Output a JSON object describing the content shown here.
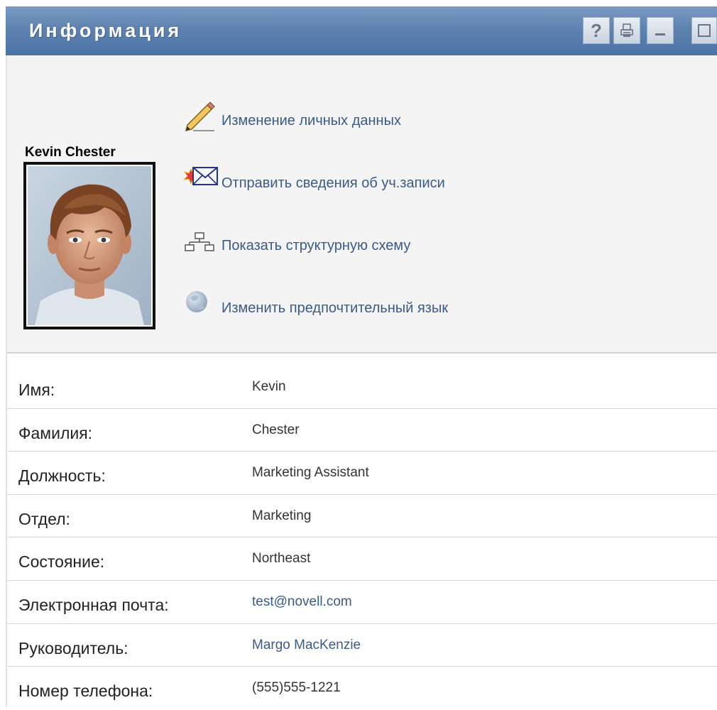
{
  "window": {
    "title": "Информация",
    "buttons": {
      "help_label": "?",
      "print_icon": "printer-icon",
      "minimize_icon": "minimize-icon",
      "maximize_icon": "maximize-icon"
    }
  },
  "user": {
    "name": "Kevin Chester",
    "photo_icon": "user-photo"
  },
  "actions": [
    {
      "icon": "pencil-icon",
      "label": "Изменение личных данных"
    },
    {
      "icon": "envelope-icon",
      "label": "Отправить сведения об уч.записи"
    },
    {
      "icon": "org-chart-icon",
      "label": "Показать структурную схему"
    },
    {
      "icon": "globe-icon",
      "label": "Изменить предпочтительный язык"
    }
  ],
  "details": [
    {
      "label": "Имя:",
      "value": "Kevin",
      "is_link": false
    },
    {
      "label": "Фамилия:",
      "value": "Chester",
      "is_link": false
    },
    {
      "label": "Должность:",
      "value": "Marketing Assistant",
      "is_link": false
    },
    {
      "label": "Отдел:",
      "value": "Marketing",
      "is_link": false
    },
    {
      "label": "Состояние:",
      "value": "Northeast",
      "is_link": false
    },
    {
      "label": "Электронная почта:",
      "value": "test@novell.com",
      "is_link": true
    },
    {
      "label": "Руководитель:",
      "value": "Margo MacKenzie",
      "is_link": true
    },
    {
      "label": "Номер телефона:",
      "value": "(555)555-1221",
      "is_link": false
    }
  ],
  "colors": {
    "titlebar": "#5e82b0",
    "link": "#3a5a89",
    "header_background": "#f4f4f4"
  }
}
